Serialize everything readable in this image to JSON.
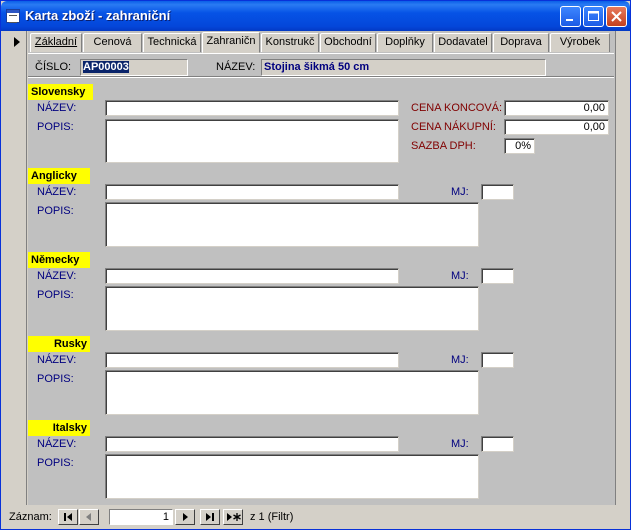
{
  "window": {
    "title": "Karta zboží - zahraniční"
  },
  "tabs": [
    {
      "label": "Základní"
    },
    {
      "label": "Cenová"
    },
    {
      "label": "Technická"
    },
    {
      "label": "Zahraničn"
    },
    {
      "label": "Konstrukč"
    },
    {
      "label": "Obchodní"
    },
    {
      "label": "Doplňky"
    },
    {
      "label": "Dodavatel"
    },
    {
      "label": "Doprava"
    },
    {
      "label": "Výrobek"
    }
  ],
  "active_tab": "Zahraničn",
  "header": {
    "cislo_label": "ČÍSLO:",
    "cislo_value": "AP00003",
    "nazev_label": "NÁZEV:",
    "nazev_value": "Stojina šikmá 50 cm"
  },
  "sections": {
    "slovensky": {
      "title": "Slovensky",
      "nazev_label": "NÁZEV:",
      "popis_label": "POPIS:",
      "cena_koncova_label": "CENA KONCOVÁ:",
      "cena_koncova_value": "0,00",
      "cena_nakupni_label": "CENA NÁKUPNÍ:",
      "cena_nakupni_value": "0,00",
      "sazba_dph_label": "SAZBA DPH:",
      "sazba_dph_value": "0%"
    },
    "anglicky": {
      "title": "Anglicky",
      "nazev_label": "NÁZEV:",
      "popis_label": "POPIS:",
      "mj_label": "MJ:"
    },
    "nemecky": {
      "title": "Německy",
      "nazev_label": "NÁZEV:",
      "popis_label": "POPIS:",
      "mj_label": "MJ:"
    },
    "rusky": {
      "title": "Rusky",
      "nazev_label": "NÁZEV:",
      "popis_label": "POPIS:",
      "mj_label": "MJ:"
    },
    "italsky": {
      "title": "Italsky",
      "nazev_label": "NÁZEV:",
      "popis_label": "POPIS:",
      "mj_label": "MJ:"
    }
  },
  "navigation": {
    "label": "Záznam:",
    "current_record": "1",
    "of_text": "z  1 (Filtr)"
  },
  "colors": {
    "titlebar": "#0653e6",
    "section_highlight": "#ffff00",
    "label_blue": "#00007f",
    "label_red": "#800000",
    "form_background": "#c0c0c0"
  }
}
